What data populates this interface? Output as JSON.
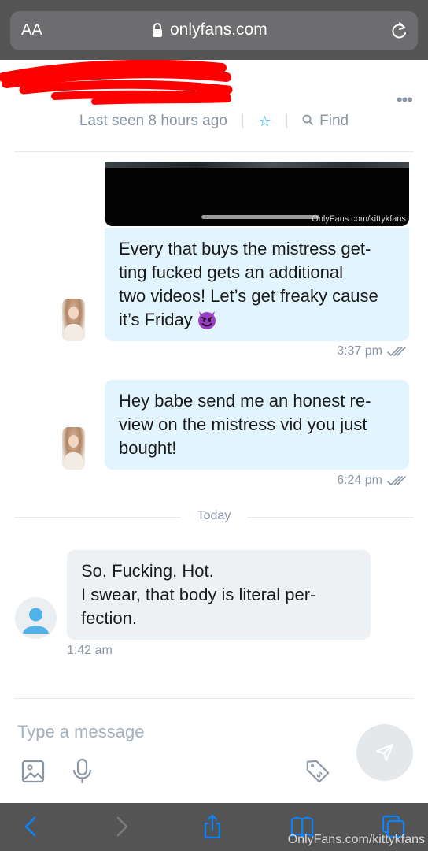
{
  "browser": {
    "text_size_label": "AA",
    "url": "onlyfans.com"
  },
  "header": {
    "last_seen": "Last seen 8 hours ago",
    "find_label": "Find"
  },
  "media": {
    "watermark": "OnlyFans.com/kittykfans"
  },
  "messages": [
    {
      "direction": "outgoing",
      "text": "Every that buys the mistress get-ting fucked gets an additional two videos! Let’s get freaky cause it’s Friday",
      "line1": "Every that buys the mistress get-",
      "line2": "ting fucked gets an additional",
      "line3": "two videos! Let’s get freaky cause",
      "line4": "it’s Friday",
      "emoji": "smiling-devil",
      "time": "3:37 pm",
      "read": true
    },
    {
      "direction": "outgoing",
      "line1": "Hey babe send me an honest re-",
      "line2": "view on the mistress vid you just",
      "line3": "bought!",
      "time": "6:24 pm",
      "read": true
    },
    {
      "direction": "incoming",
      "line1": "So. Fucking. Hot.",
      "line2": "I swear, that body is literal per-",
      "line3": "fection.",
      "time": "1:42 am"
    }
  ],
  "divider": {
    "label": "Today"
  },
  "composer": {
    "placeholder": "Type a message"
  },
  "watermark_bottom": "OnlyFans.com/kittykfans",
  "colors": {
    "accent": "#00aff0",
    "outgoing_bubble": "#e2f4fd",
    "incoming_bubble": "#eef1f4",
    "muted_text": "#8a96a3",
    "browser_chrome": "#545455",
    "ios_link": "#0a84ff"
  }
}
